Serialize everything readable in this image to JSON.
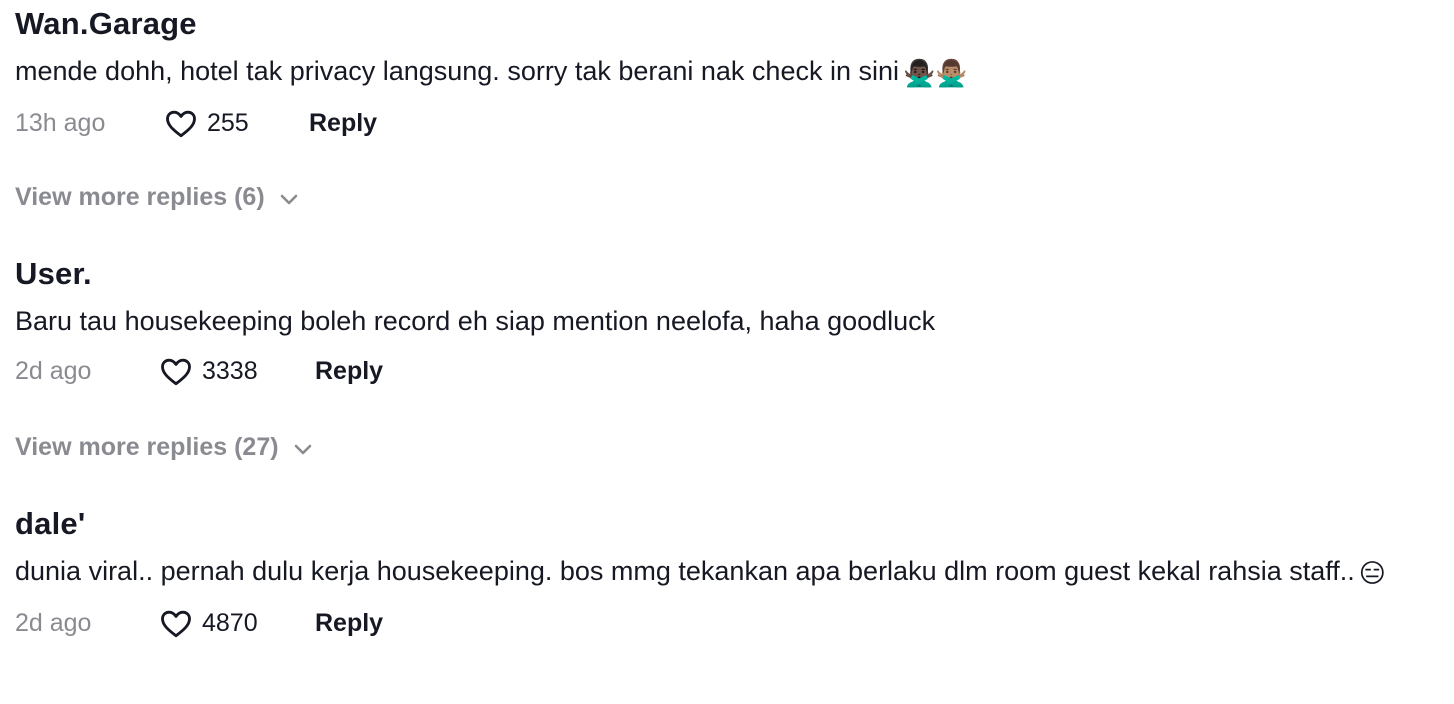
{
  "comments": [
    {
      "username": "Wan.Garage",
      "text": "mende dohh, hotel tak privacy langsung. sorry tak berani nak check in sini",
      "emoji": "🙅🏿‍♂️🙅🏽‍♂️",
      "time": "13h ago",
      "likes": "255",
      "reply_label": "Reply",
      "view_more": "View more replies (6)"
    },
    {
      "username": "User.",
      "text": "Baru tau housekeeping boleh record eh siap mention neelofa, haha goodluck",
      "time": "2d ago",
      "likes": "3338",
      "reply_label": "Reply",
      "view_more": "View more replies (27)"
    },
    {
      "username": "dale'",
      "text": "dunia viral.. pernah dulu kerja housekeeping. bos mmg tekankan apa berlaku dlm room guest kekal rahsia staff..",
      "emoji": "😑",
      "time": "2d ago",
      "likes": "4870",
      "reply_label": "Reply"
    }
  ],
  "icons": {
    "like": "heart-outline-icon",
    "expand": "chevron-down-icon"
  }
}
